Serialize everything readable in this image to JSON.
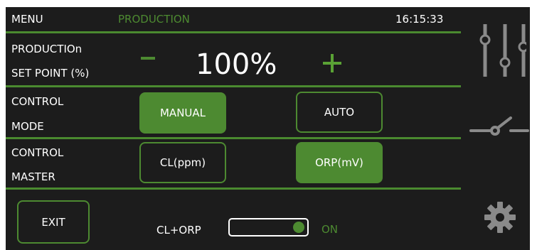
{
  "header": {
    "menu_label": "MENU",
    "section_title": "PRODUCTION",
    "clock": "16:15:33"
  },
  "production": {
    "label_line1": "PRODUCTIOn",
    "label_line2": "SET POINT (%)",
    "minus_symbol": "-",
    "value": "100%",
    "plus_symbol": "+"
  },
  "control_mode": {
    "label_line1": "CONTROL",
    "label_line2": "MODE",
    "options": [
      "MANUAL",
      "AUTO"
    ],
    "selected": "MANUAL"
  },
  "control_master": {
    "label_line1": "CONTROL",
    "label_line2": "MASTER",
    "options": [
      "CL(ppm)",
      "ORP(mV)"
    ],
    "selected": "ORP(mV)"
  },
  "footer": {
    "exit_label": "EXIT",
    "toggle_label": "CL+ORP",
    "toggle_state": "ON"
  },
  "sidebar": {
    "icons": [
      "sliders-icon",
      "switch-icon",
      "gear-icon"
    ]
  },
  "colors": {
    "accent": "#4d8a31",
    "background": "#1c1c1c",
    "icon_gray": "#8a8a8a"
  }
}
